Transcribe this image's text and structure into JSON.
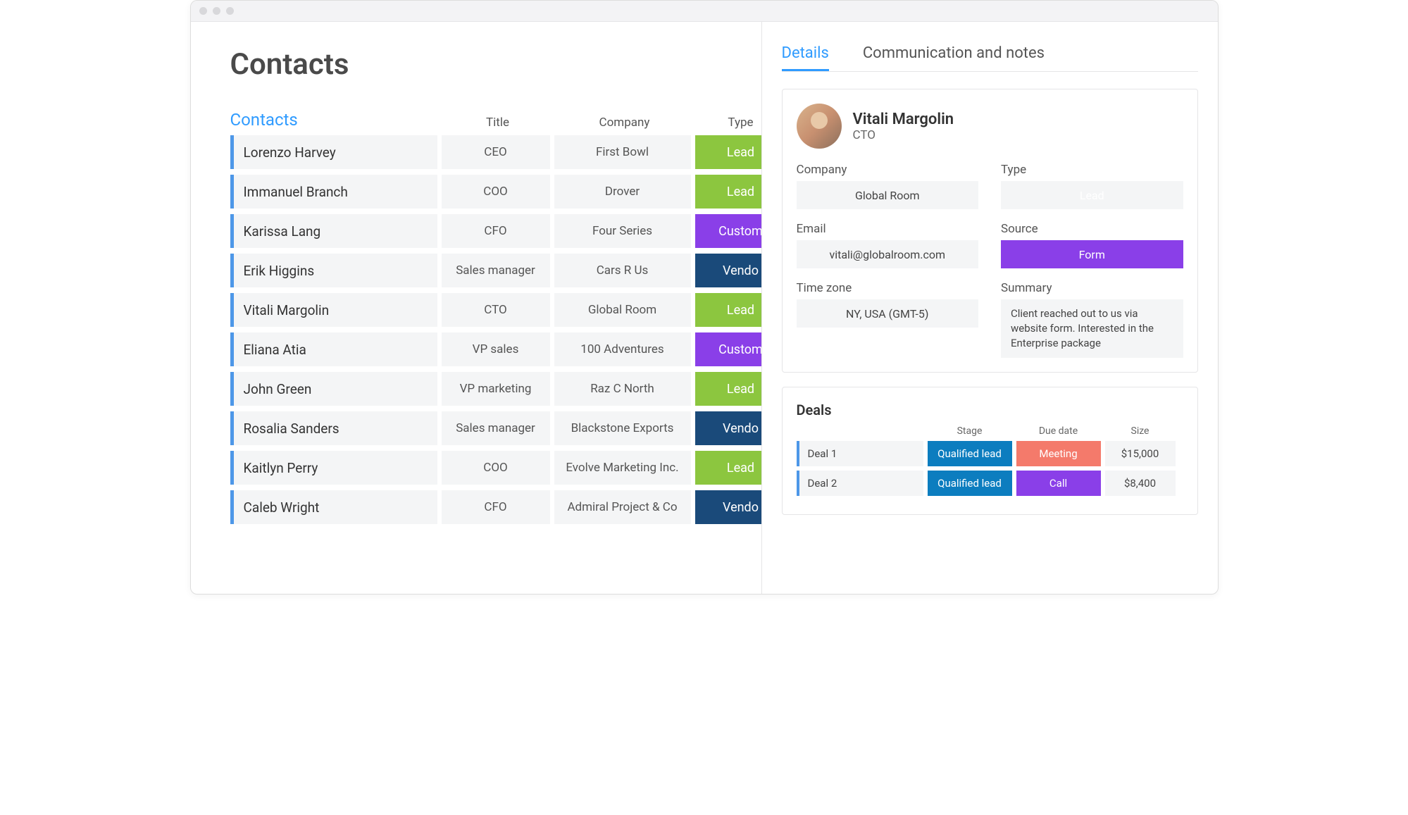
{
  "page_title": "Contacts",
  "table": {
    "head_label": "Contacts",
    "columns": [
      "Title",
      "Company",
      "Type"
    ],
    "rows": [
      {
        "name": "Lorenzo Harvey",
        "title": "CEO",
        "company": "First Bowl",
        "type": "Lead",
        "type_class": "type-lead"
      },
      {
        "name": "Immanuel Branch",
        "title": "COO",
        "company": "Drover",
        "type": "Lead",
        "type_class": "type-lead"
      },
      {
        "name": "Karissa Lang",
        "title": "CFO",
        "company": "Four Series",
        "type": "Custom",
        "type_class": "type-customer"
      },
      {
        "name": "Erik Higgins",
        "title": "Sales manager",
        "company": "Cars R Us",
        "type": "Vendo",
        "type_class": "type-vendor"
      },
      {
        "name": "Vitali Margolin",
        "title": "CTO",
        "company": "Global Room",
        "type": "Lead",
        "type_class": "type-lead"
      },
      {
        "name": "Eliana Atia",
        "title": "VP sales",
        "company": "100 Adventures",
        "type": "Custom",
        "type_class": "type-customer"
      },
      {
        "name": "John Green",
        "title": "VP marketing",
        "company": "Raz C North",
        "type": "Lead",
        "type_class": "type-lead"
      },
      {
        "name": "Rosalia Sanders",
        "title": "Sales manager",
        "company": "Blackstone Exports",
        "type": "Vendo",
        "type_class": "type-vendor"
      },
      {
        "name": "Kaitlyn Perry",
        "title": "COO",
        "company": "Evolve Marketing Inc.",
        "type": "Lead",
        "type_class": "type-lead"
      },
      {
        "name": "Caleb Wright",
        "title": "CFO",
        "company": "Admiral Project & Co",
        "type": "Vendo",
        "type_class": "type-vendor"
      }
    ]
  },
  "tabs": {
    "details": "Details",
    "comm": "Communication and notes"
  },
  "detail": {
    "name": "Vitali Margolin",
    "title": "CTO",
    "labels": {
      "company": "Company",
      "type": "Type",
      "email": "Email",
      "source": "Source",
      "timezone": "Time zone",
      "summary": "Summary"
    },
    "company": "Global Room",
    "type": "Lead",
    "type_class": "type-lead",
    "email": "vitali@globalroom.com",
    "source": "Form",
    "source_class": "src-form",
    "timezone": "NY, USA (GMT-5)",
    "summary": "Client reached out to us via website form. Interested in the Enterprise package"
  },
  "deals": {
    "title": "Deals",
    "columns": [
      "",
      "Stage",
      "Due date",
      "Size"
    ],
    "rows": [
      {
        "name": "Deal 1",
        "stage": "Qualified lead",
        "stage_class": "stage-qualified",
        "due": "Meeting",
        "due_class": "due-meeting",
        "size": "$15,000"
      },
      {
        "name": "Deal 2",
        "stage": "Qualified lead",
        "stage_class": "stage-qualified",
        "due": "Call",
        "due_class": "due-call",
        "size": "$8,400"
      }
    ]
  }
}
